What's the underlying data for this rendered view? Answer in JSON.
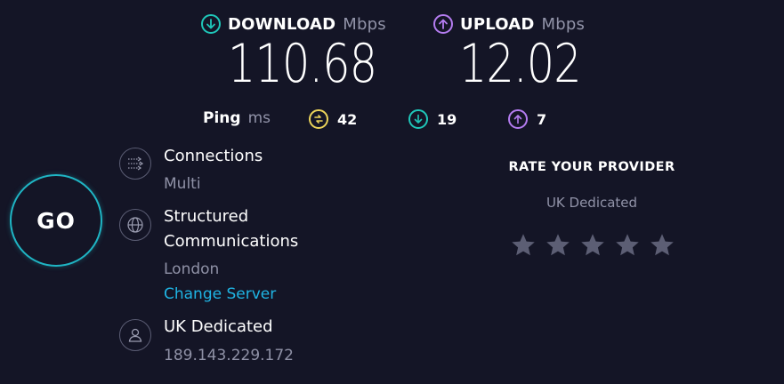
{
  "download": {
    "label": "DOWNLOAD",
    "unit": "Mbps",
    "value": "110.68",
    "icon": "download-arrow-icon",
    "color": "#1fc7b9"
  },
  "upload": {
    "label": "UPLOAD",
    "unit": "Mbps",
    "value": "12.02",
    "icon": "upload-arrow-icon",
    "color": "#b47cf0"
  },
  "ping": {
    "label": "Ping",
    "unit": "ms",
    "idle": {
      "value": "42",
      "icon": "idle-ping-icon",
      "color": "#ecd45a"
    },
    "download": {
      "value": "19",
      "icon": "download-ping-icon",
      "color": "#1fc7b9"
    },
    "upload": {
      "value": "7",
      "icon": "upload-ping-icon",
      "color": "#b47cf0"
    }
  },
  "go_button": {
    "label": "GO",
    "color": "#1fb5c4"
  },
  "connections": {
    "title": "Connections",
    "value": "Multi",
    "icon": "connections-icon"
  },
  "server": {
    "name_line1": "Structured",
    "name_line2": "Communications",
    "location": "London",
    "change_link": "Change Server",
    "icon": "globe-icon"
  },
  "provider": {
    "name": "UK Dedicated",
    "ip": "189.143.229.172",
    "icon": "user-icon"
  },
  "rating": {
    "title": "RATE YOUR PROVIDER",
    "provider_name": "UK Dedicated",
    "stars_total": 5,
    "stars_selected": 0,
    "star_color": "#5c5e74"
  }
}
